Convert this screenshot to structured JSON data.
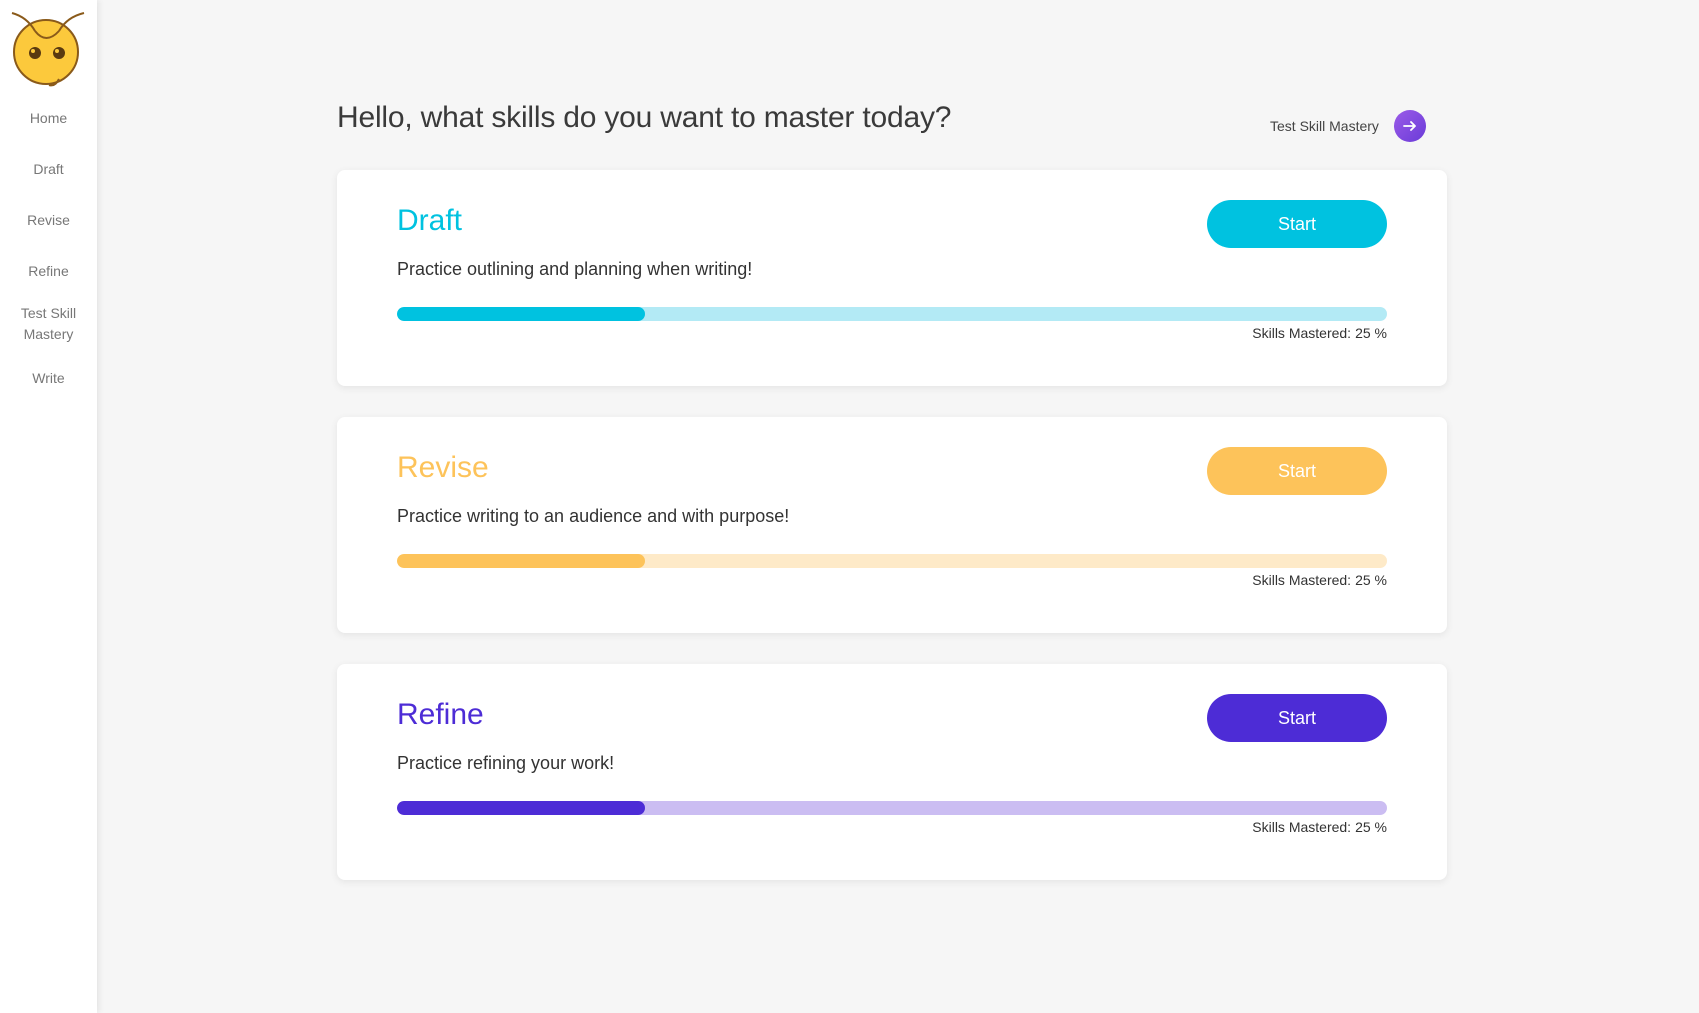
{
  "sidebar": {
    "items": [
      {
        "label": "Home"
      },
      {
        "label": "Draft"
      },
      {
        "label": "Revise"
      },
      {
        "label": "Refine"
      },
      {
        "label": "Test Skill",
        "label2": "Mastery"
      },
      {
        "label": "Write"
      }
    ]
  },
  "header": {
    "greeting": "Hello, what skills do you want to master today?",
    "test_link_label": "Test Skill Mastery"
  },
  "cards": [
    {
      "title": "Draft",
      "description": "Practice outlining and planning when writing!",
      "button_label": "Start",
      "mastered_label": "Skills Mastered:",
      "mastered_value": "25 %",
      "progress": 0.25,
      "color": "#00c2e0",
      "track_color": "#b3eaf5"
    },
    {
      "title": "Revise",
      "description": "Practice writing to an audience and with purpose!",
      "button_label": "Start",
      "mastered_label": "Skills Mastered:",
      "mastered_value": "25 %",
      "progress": 0.25,
      "color": "#fdc35a",
      "track_color": "#feeac8"
    },
    {
      "title": "Refine",
      "description": "Practice refining your work!",
      "button_label": "Start",
      "mastered_label": "Skills Mastered:",
      "mastered_value": "25 %",
      "progress": 0.25,
      "color": "#4d2cd6",
      "track_color": "#cbbdf2"
    }
  ],
  "icons": {
    "logo": "owl-logo-icon",
    "arrow": "arrow-right-icon"
  }
}
